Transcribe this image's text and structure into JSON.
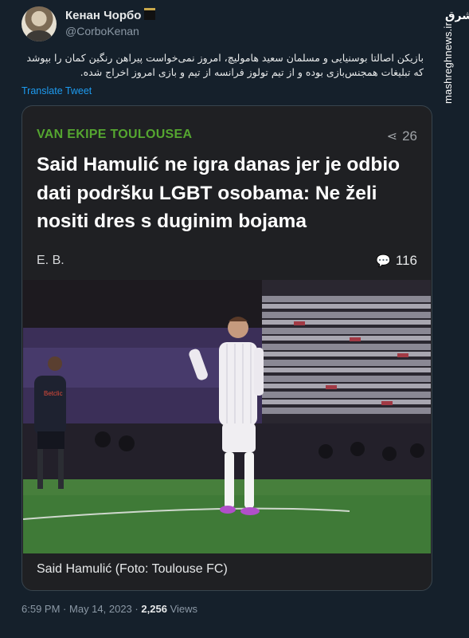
{
  "author": {
    "name": "Кенан Чорбо",
    "handle": "@CorboKenan"
  },
  "tweet": {
    "text": "بازیکن اصالتا بوسنیایی و مسلمان سعید هاموليچ، امروز نمی‌خواست پیراهن رنگین کمان را بپوشد که تبلیغات همجنس‌بازی بوده و از تیم تولوز فرانسه از تیم و بازی امروز اخراج شده.",
    "translate_label": "Translate Tweet"
  },
  "card": {
    "kicker": "VAN EKIPE TOULOUSEA",
    "share_count": "26",
    "headline": "Said Hamulić ne igra danas jer je odbio dati podršku LGBT osobama: Ne želi nositi dres s duginim bojama",
    "author_initials": "E. B.",
    "comment_count": "116",
    "image_caption": "Said Hamulić (Foto: Toulouse FC)",
    "ad_board_text": "Betclic"
  },
  "meta": {
    "time": "6:59 PM",
    "separator": "·",
    "date": "May 14, 2023",
    "views_count": "2,256",
    "views_label": "Views"
  },
  "watermark": {
    "url": "mashreghnews.ir",
    "logo_text": "مشرق"
  },
  "colors": {
    "background": "#15202b",
    "card_bg": "#1f2023",
    "kicker_green": "#55a630",
    "link_blue": "#1d9bf0",
    "muted": "#8b98a5"
  },
  "icons": {
    "share": "share-icon",
    "comments": "comments-icon"
  }
}
